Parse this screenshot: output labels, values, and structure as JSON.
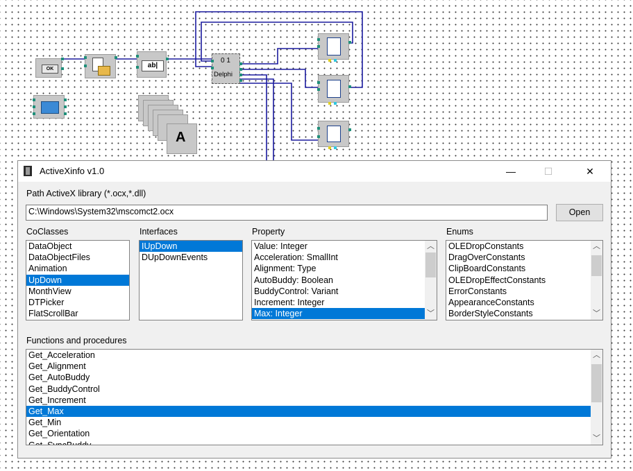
{
  "canvas": {
    "ok_component_label": "OK",
    "edit_component_label": "ab|",
    "delphi_component_label": "Delphi",
    "delphi_component_value": "0 1",
    "text_component_label": "A"
  },
  "window": {
    "title": "ActiveXinfo v1.0",
    "minimize": "—",
    "maximize": "☐",
    "close": "✕"
  },
  "path": {
    "label": "Path ActiveX library (*.ocx,*.dll)",
    "value": "C:\\Windows\\System32\\mscomct2.ocx",
    "open_button": "Open"
  },
  "coclasses": {
    "label": "CoClasses",
    "items": [
      "DataObject",
      "DataObjectFiles",
      "Animation",
      "UpDown",
      "MonthView",
      "DTPicker",
      "FlatScrollBar"
    ],
    "selected": "UpDown"
  },
  "interfaces": {
    "label": "Interfaces",
    "items": [
      "IUpDown",
      "DUpDownEvents"
    ],
    "selected": "IUpDown"
  },
  "property": {
    "label": "Property",
    "items": [
      "Value: Integer",
      "Acceleration: SmallInt",
      "Alignment: Type",
      "AutoBuddy: Boolean",
      "BuddyControl: Variant",
      "Increment: Integer",
      "Max: Integer"
    ],
    "selected": "Max: Integer"
  },
  "enums": {
    "label": "Enums",
    "items": [
      "OLEDropConstants",
      "DragOverConstants",
      "ClipBoardConstants",
      "OLEDropEffectConstants",
      "ErrorConstants",
      "AppearanceConstants",
      "BorderStyleConstants"
    ]
  },
  "functions": {
    "label": "Functions and procedures",
    "items": [
      "Get_Acceleration",
      "Get_Alignment",
      "Get_AutoBuddy",
      "Get_BuddyControl",
      "Get_Increment",
      "Get_Max",
      "Get_Min",
      "Get_Orientation",
      "Get_SyncBuddy"
    ],
    "selected": "Get_Max"
  },
  "colors": {
    "selection": "#0078d7",
    "wire": "#1a1a9e",
    "port": "#1f8f7a"
  }
}
